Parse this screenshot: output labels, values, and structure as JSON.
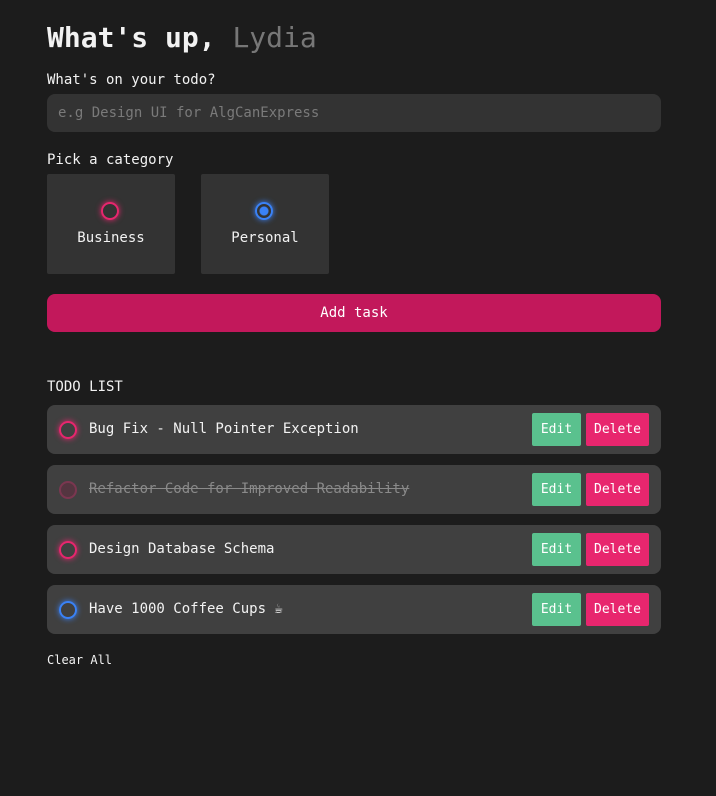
{
  "header": {
    "greeting": "What's up,",
    "name": "Lydia"
  },
  "form": {
    "todo_label": "What's on your todo?",
    "todo_placeholder": "e.g Design UI for AlgCanExpress",
    "todo_value": "",
    "category_label": "Pick a category",
    "categories": [
      {
        "label": "Business",
        "color": "#e8266e",
        "selected": false
      },
      {
        "label": "Personal",
        "color": "#3a82f7",
        "selected": true
      }
    ],
    "add_button": "Add task"
  },
  "todo_list": {
    "title": "TODO LIST",
    "items": [
      {
        "text": "Bug Fix - Null Pointer Exception",
        "category": "business",
        "done": false,
        "edit": "Edit",
        "delete": "Delete"
      },
      {
        "text": "Refactor Code for Improved Readability",
        "category": "business",
        "done": true,
        "edit": "Edit",
        "delete": "Delete"
      },
      {
        "text": "Design Database Schema",
        "category": "business",
        "done": false,
        "edit": "Edit",
        "delete": "Delete"
      },
      {
        "text": "Have 1000 Coffee Cups ☕",
        "category": "personal",
        "done": false,
        "edit": "Edit",
        "delete": "Delete"
      }
    ],
    "clear_all": "Clear All"
  },
  "colors": {
    "background": "#1c1c1c",
    "business": "#e8266e",
    "personal": "#3a82f7",
    "primary": "#c2185b",
    "edit": "#5ac18e",
    "delete": "#e8266e"
  }
}
